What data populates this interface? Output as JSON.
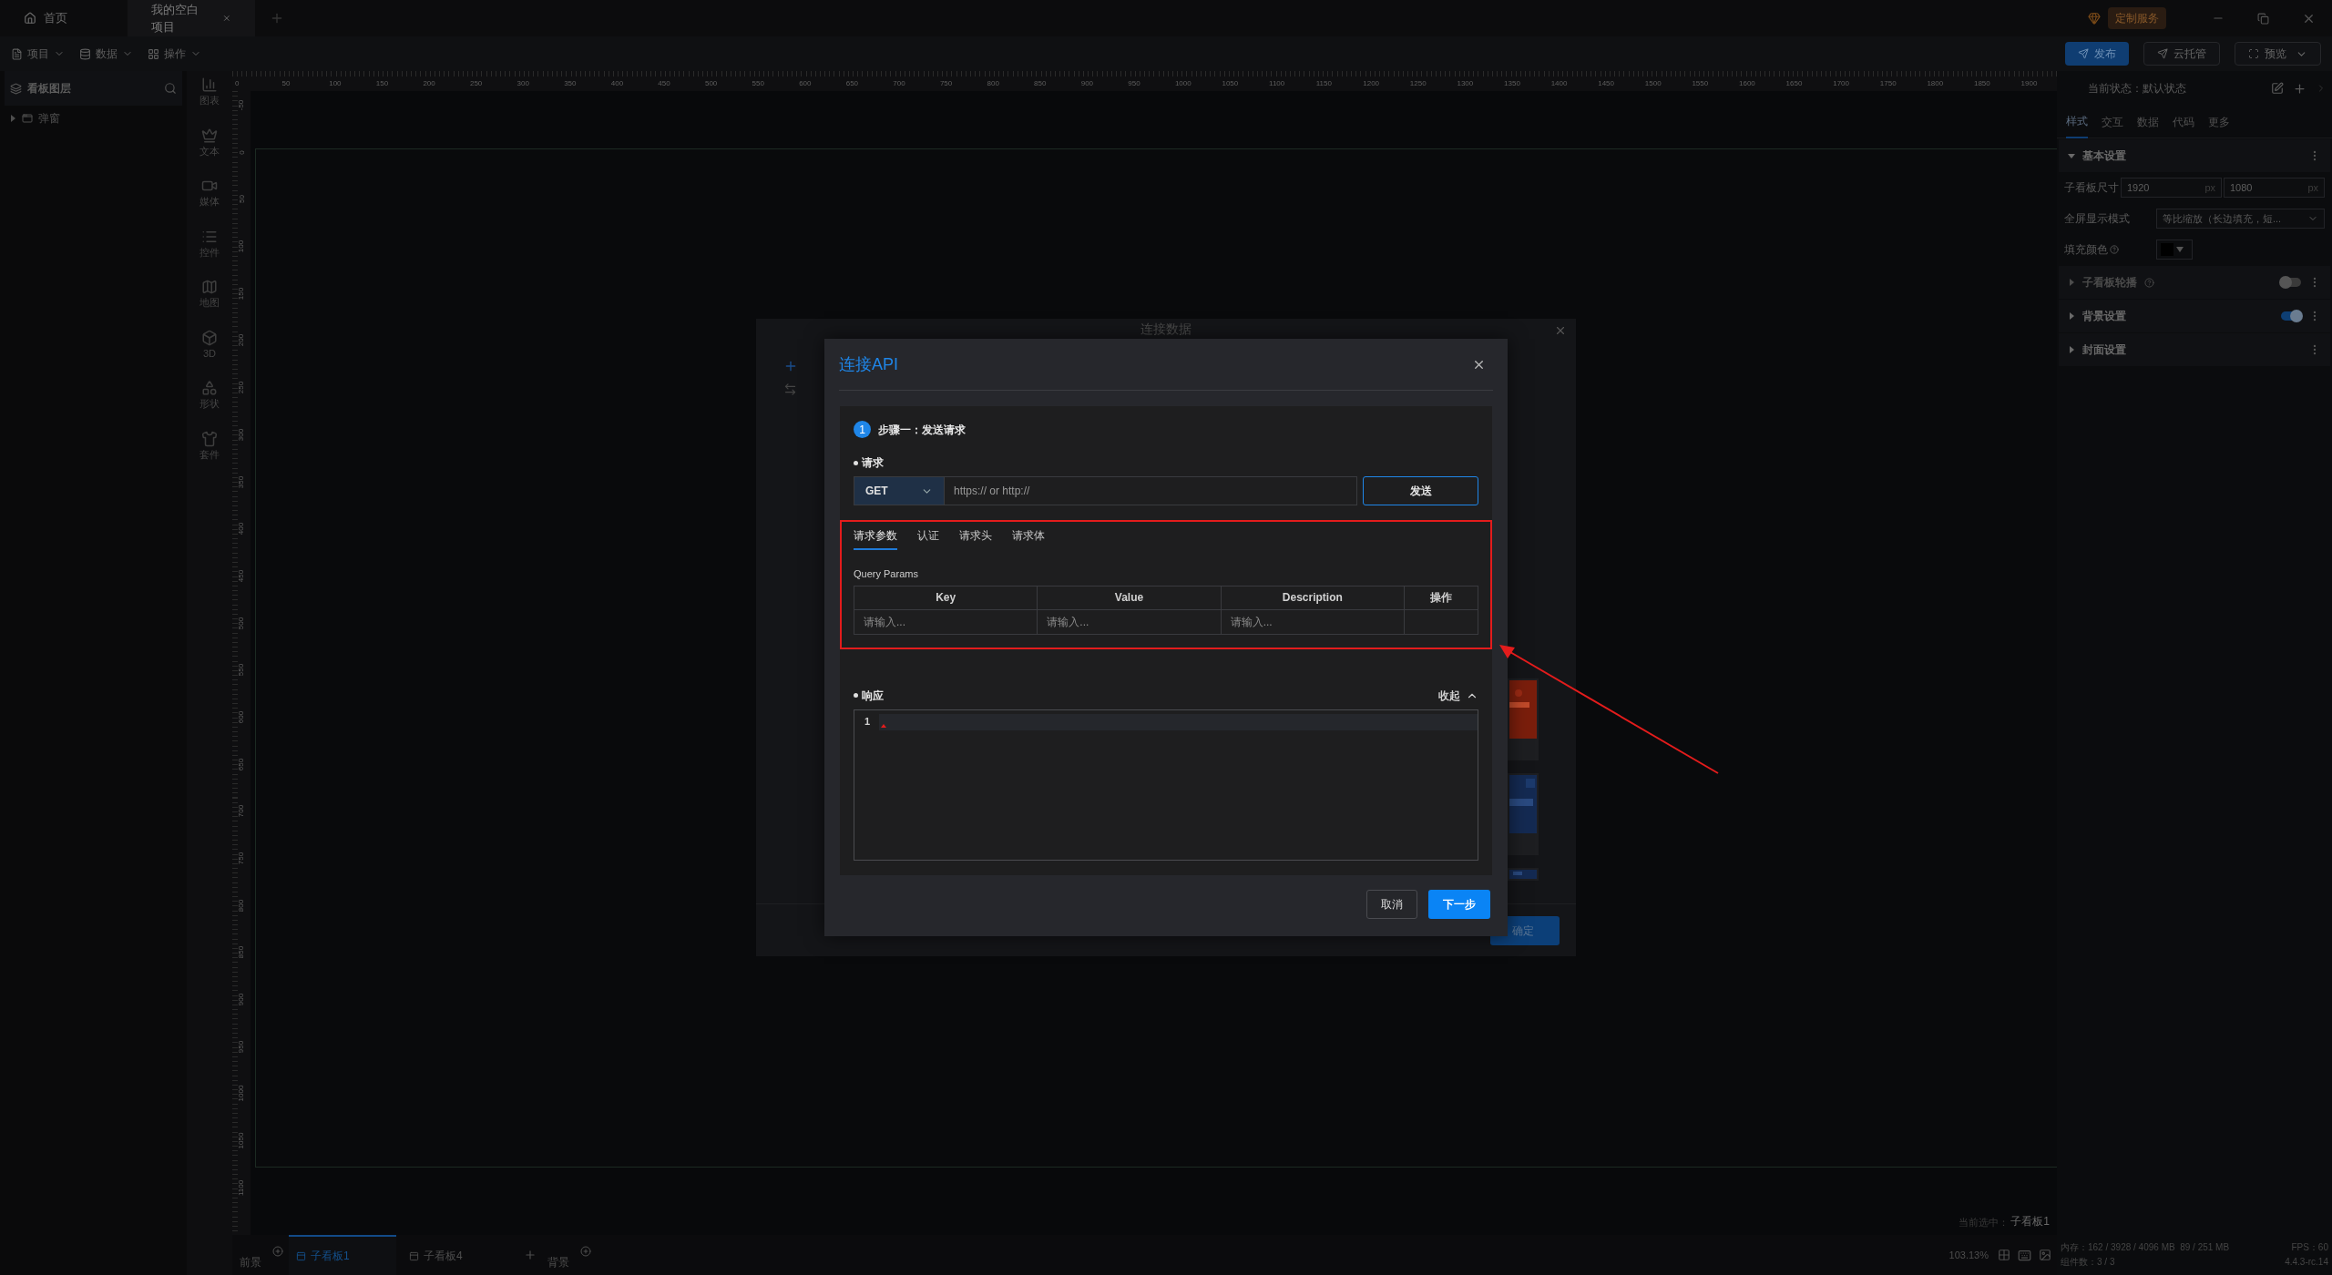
{
  "title_bar": {
    "tabs": [
      {
        "kind": "home",
        "label": "首页",
        "selected": false,
        "closable": false
      },
      {
        "kind": "project",
        "label": "我的空白项目",
        "selected": true,
        "closable": true
      }
    ],
    "service_badge": "定制服务"
  },
  "toolbar": {
    "menus": [
      {
        "kind": "file",
        "label": "项目"
      },
      {
        "kind": "data",
        "label": "数据"
      },
      {
        "kind": "grid",
        "label": "操作"
      }
    ],
    "actions": [
      {
        "kind": "primary",
        "label": "发布"
      },
      {
        "kind": "default",
        "label": "云托管"
      },
      {
        "kind": "dropdown",
        "label": "预览"
      }
    ]
  },
  "layers_panel": {
    "title": "看板图层",
    "items": [
      {
        "label": "弹窗",
        "expanded": false
      }
    ]
  },
  "component_bar": [
    {
      "kind": "chart",
      "label": "图表"
    },
    {
      "kind": "text",
      "label": "文本"
    },
    {
      "kind": "media",
      "label": "媒体"
    },
    {
      "kind": "control",
      "label": "控件"
    },
    {
      "kind": "map",
      "label": "地图"
    },
    {
      "kind": "cube",
      "label": "3D"
    },
    {
      "kind": "shape",
      "label": "形状"
    },
    {
      "kind": "kit",
      "label": "套件"
    }
  ],
  "ruler": {
    "x_ticks": [
      "0",
      "50",
      "100",
      "150",
      "200",
      "250",
      "300",
      "350",
      "400",
      "450",
      "500",
      "550",
      "600",
      "650",
      "700",
      "750",
      "800",
      "850",
      "900",
      "950",
      "1000",
      "1050",
      "1100",
      "1150",
      "1200",
      "1250",
      "1300",
      "1350",
      "1400",
      "1450",
      "1500",
      "1550",
      "1600",
      "1650",
      "1700",
      "1750",
      "1800",
      "1850",
      "1900"
    ],
    "y_ticks": [
      "-50",
      "0",
      "50",
      "100",
      "150",
      "200",
      "250",
      "300",
      "350",
      "400",
      "450",
      "500",
      "550",
      "600",
      "650",
      "700",
      "750",
      "800",
      "850",
      "900",
      "950",
      "1000",
      "1050",
      "1100"
    ]
  },
  "canvas": {
    "selection_label": "当前选中：",
    "selection_value": "子看板1"
  },
  "bottom_bar": {
    "front_label": "前景",
    "tabs": [
      {
        "label": "子看板1",
        "selected": true
      },
      {
        "label": "子看板4",
        "selected": false
      }
    ],
    "back_label": "背景",
    "zoom": "103.13%"
  },
  "properties_panel": {
    "state_label": "当前状态：默认状态",
    "tabs": [
      {
        "label": "样式",
        "selected": true
      },
      {
        "label": "交互",
        "selected": false
      },
      {
        "label": "数据",
        "selected": false
      },
      {
        "label": "代码",
        "selected": false
      },
      {
        "label": "更多",
        "selected": false
      }
    ],
    "sections": [
      {
        "title": "基本设置",
        "expanded": true,
        "disabled": false,
        "help": false,
        "fields": [
          {
            "kind": "size",
            "label": "子看板尺寸",
            "help": false,
            "inputs": [
              {
                "value": "1920",
                "unit": "px"
              },
              {
                "value": "1080",
                "unit": "px"
              }
            ]
          },
          {
            "kind": "select",
            "label": "全屏显示模式",
            "help": false,
            "value": "等比缩放（长边填充，短..."
          },
          {
            "kind": "color",
            "label": "填充颜色",
            "help": true,
            "color": "#000000"
          }
        ]
      },
      {
        "title": "子看板轮播",
        "expanded": false,
        "disabled": true,
        "help": true,
        "toggle": false
      },
      {
        "title": "背景设置",
        "expanded": false,
        "disabled": false,
        "help": false,
        "toggle": true
      },
      {
        "title": "封面设置",
        "expanded": false,
        "disabled": false,
        "help": false
      }
    ],
    "status": {
      "memory": "内存：162 / 3928 / 4096 MB  89 / 251 MB",
      "fps": "FPS：60",
      "components": "组件数：3 / 3",
      "version": "4.4.3-rc.14"
    }
  },
  "connect_data_dialog": {
    "title": "连接数据",
    "confirm": "确定"
  },
  "api_dialog": {
    "title": "连接API",
    "step_number": "1",
    "step_title": "步骤一：发送请求",
    "request_label": "请求",
    "method": "GET",
    "url_placeholder": "https:// or http://",
    "send": "发送",
    "tabs": [
      {
        "label": "请求参数",
        "selected": true
      },
      {
        "label": "认证",
        "selected": false
      },
      {
        "label": "请求头",
        "selected": false
      },
      {
        "label": "请求体",
        "selected": false
      }
    ],
    "params_title": "Query Params",
    "columns": [
      "Key",
      "Value",
      "Description",
      "操作"
    ],
    "row_placeholders": [
      "请输入...",
      "请输入...",
      "请输入..."
    ],
    "response_label": "响应",
    "collapse": "收起",
    "line_numbers": [
      "1"
    ],
    "cancel": "取消",
    "next": "下一步"
  },
  "annotation": {
    "highlight": true,
    "arrow": true
  }
}
